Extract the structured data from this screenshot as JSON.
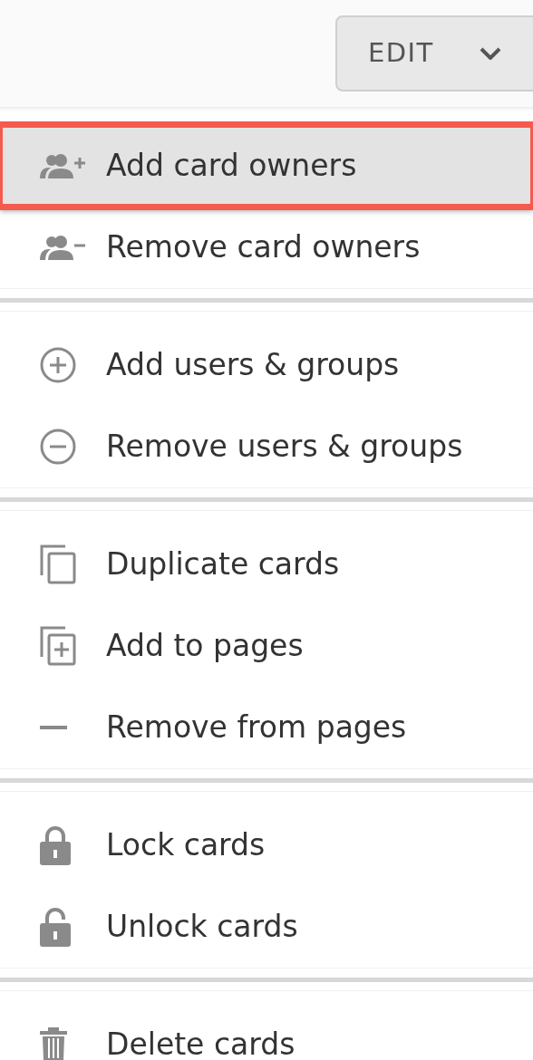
{
  "edit_button": {
    "label": "EDIT"
  },
  "menu": {
    "sections": [
      {
        "items": [
          {
            "kind": "add-owners",
            "label": "Add card owners",
            "selected": true
          },
          {
            "kind": "remove-owners",
            "label": "Remove card owners",
            "selected": false
          }
        ]
      },
      {
        "items": [
          {
            "kind": "add-users",
            "label": "Add users & groups",
            "selected": false
          },
          {
            "kind": "remove-users",
            "label": "Remove users & groups",
            "selected": false
          }
        ]
      },
      {
        "items": [
          {
            "kind": "duplicate",
            "label": "Duplicate cards",
            "selected": false
          },
          {
            "kind": "add-pages",
            "label": "Add to pages",
            "selected": false
          },
          {
            "kind": "remove-pages",
            "label": "Remove from pages",
            "selected": false
          }
        ]
      },
      {
        "items": [
          {
            "kind": "lock",
            "label": "Lock cards",
            "selected": false
          },
          {
            "kind": "unlock",
            "label": "Unlock cards",
            "selected": false
          }
        ]
      },
      {
        "items": [
          {
            "kind": "delete",
            "label": "Delete cards",
            "selected": false
          }
        ]
      }
    ]
  }
}
